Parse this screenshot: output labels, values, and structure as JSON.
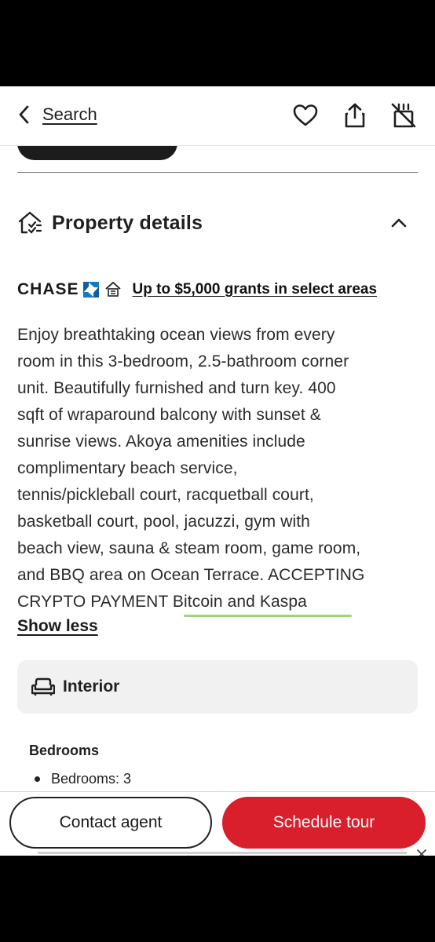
{
  "header": {
    "back_label": "Search"
  },
  "section": {
    "title": "Property details"
  },
  "chase": {
    "brand": "CHASE",
    "link": "Up to $5,000 grants in select areas"
  },
  "description": {
    "lines": [
      "Enjoy breathtaking ocean views from every",
      "room in this 3-bedroom, 2.5-bathroom corner",
      "unit. Beautifully furnished and turn key. 400",
      "sqft of wraparound balcony with sunset &",
      "sunrise views. Akoya amenities include",
      "complimentary beach service,",
      "tennis/pickleball court, racquetball court,",
      "basketball court, pool, jacuzzi, gym with",
      "beach view, sauna & steam room, game room,",
      "and BBQ area on Ocean Terrace. ACCEPTING",
      "CRYPTO PAYMENT Bitcoin and Kaspa"
    ],
    "toggle": "Show less"
  },
  "interior": {
    "label": "Interior"
  },
  "bedrooms": {
    "title": "Bedrooms",
    "item": "Bedrooms: 3"
  },
  "actions": {
    "contact": "Contact agent",
    "tour": "Schedule tour"
  },
  "colors": {
    "accent": "#d91f2b",
    "highlight": "#9bd47a",
    "chase_blue": "#117aca"
  },
  "icons": [
    "back-chevron-icon",
    "heart-icon",
    "share-icon",
    "hide-icon",
    "house-checklist-icon",
    "chevron-up-icon",
    "chase-logo-icon",
    "equal-housing-icon",
    "armchair-icon",
    "close-icon"
  ]
}
